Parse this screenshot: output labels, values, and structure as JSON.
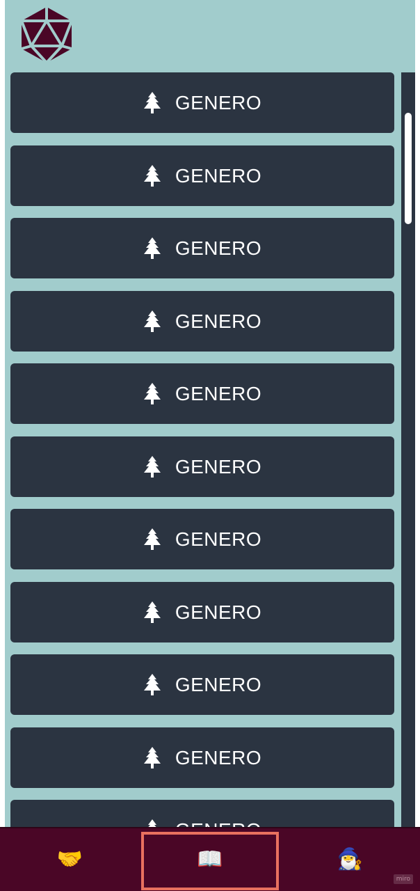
{
  "colors": {
    "background": "#a1cccc",
    "card": "#2b3441",
    "nav": "#4a0626",
    "logo": "#4a0626",
    "active_outline": "#e8715f"
  },
  "logo": {
    "icon": "d20-dice-icon"
  },
  "genres": [
    {
      "label": "GENERO",
      "icon": "tree-icon"
    },
    {
      "label": "GENERO",
      "icon": "tree-icon"
    },
    {
      "label": "GENERO",
      "icon": "tree-icon"
    },
    {
      "label": "GENERO",
      "icon": "tree-icon"
    },
    {
      "label": "GENERO",
      "icon": "tree-icon"
    },
    {
      "label": "GENERO",
      "icon": "tree-icon"
    },
    {
      "label": "GENERO",
      "icon": "tree-icon"
    },
    {
      "label": "GENERO",
      "icon": "tree-icon"
    },
    {
      "label": "GENERO",
      "icon": "tree-icon"
    },
    {
      "label": "GENERO",
      "icon": "tree-icon"
    },
    {
      "label": "GENERO",
      "icon": "tree-icon"
    }
  ],
  "nav": {
    "items": [
      {
        "icon": "handshake-icon",
        "glyph": "🤝",
        "active": false
      },
      {
        "icon": "open-book-icon",
        "glyph": "📖",
        "active": true
      },
      {
        "icon": "wizard-icon",
        "glyph": "🧙‍♂️",
        "active": false
      }
    ]
  },
  "watermark": "miro"
}
